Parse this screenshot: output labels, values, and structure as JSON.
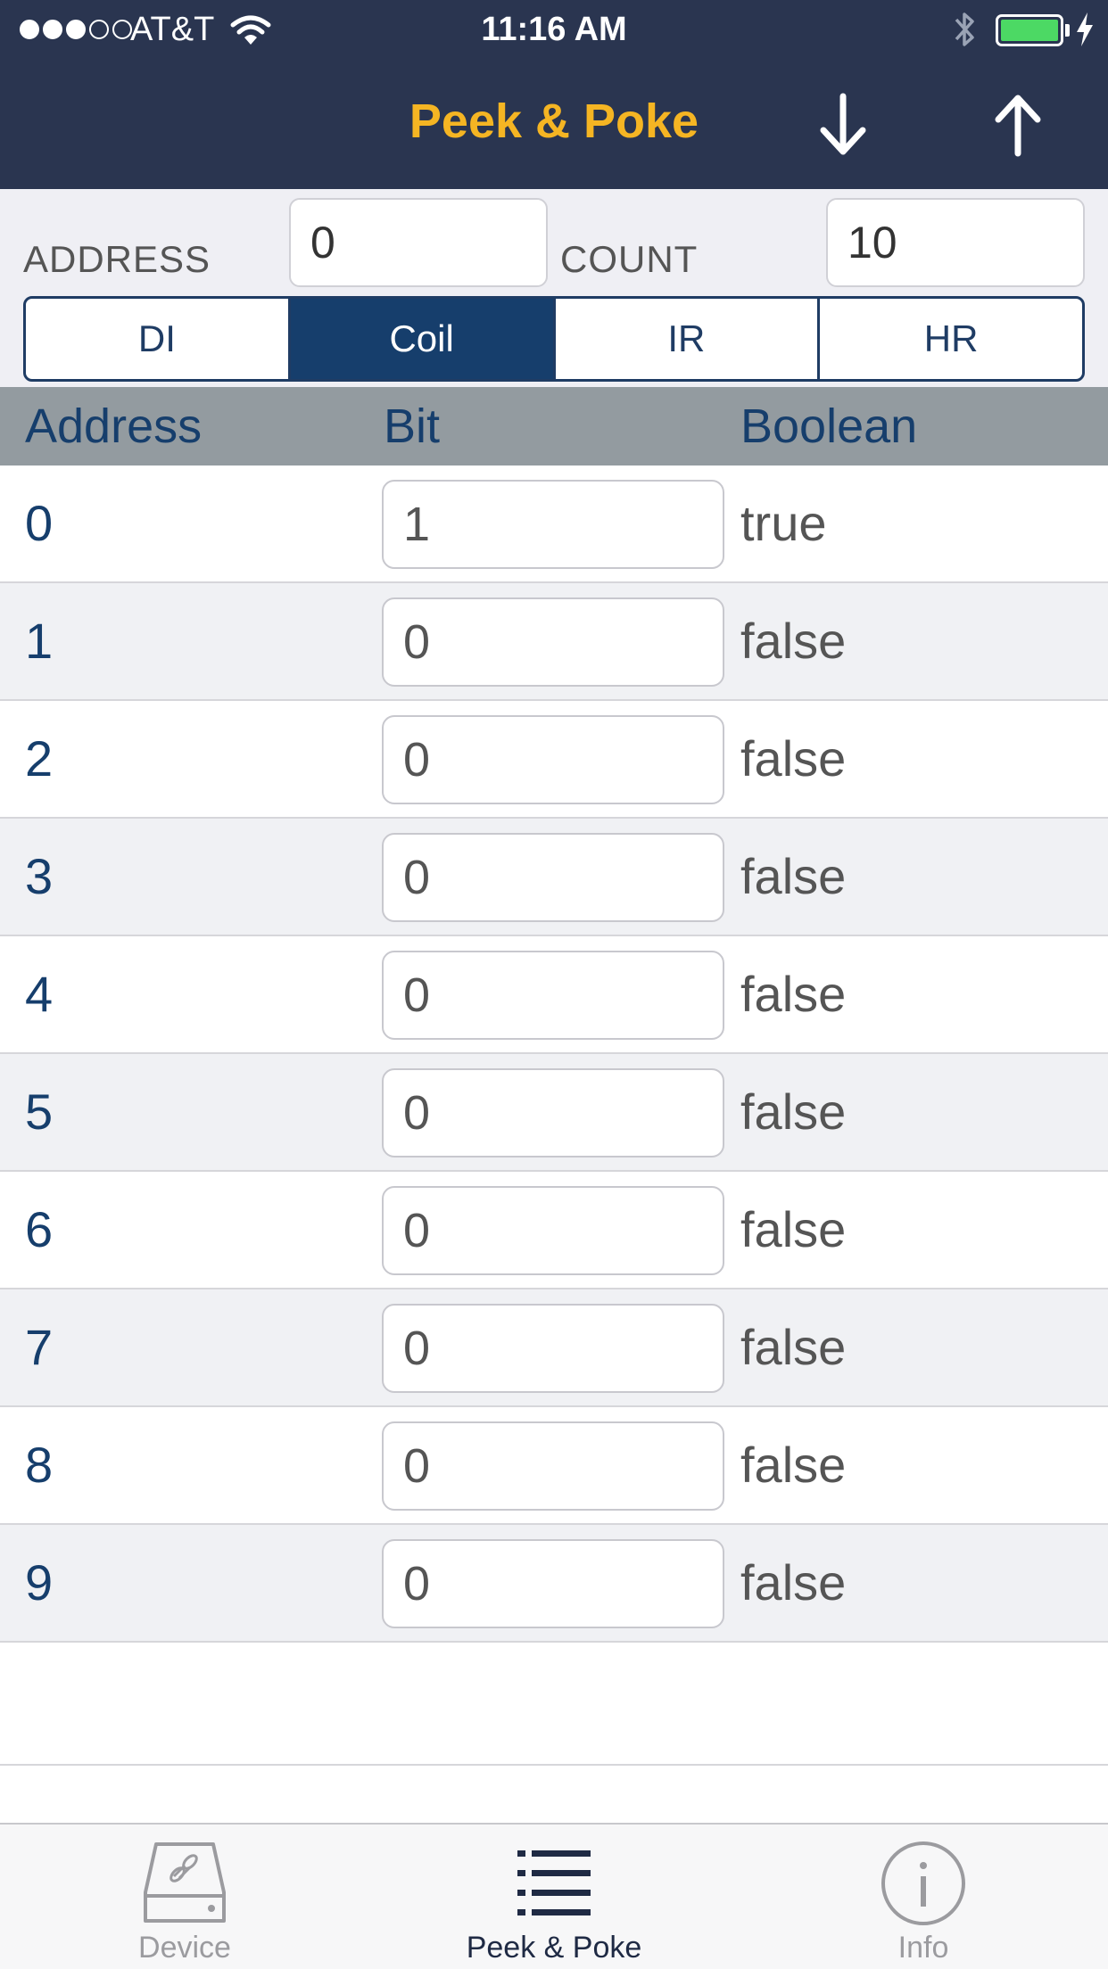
{
  "status_bar": {
    "carrier": "AT&T",
    "time": "11:16 AM",
    "signal_bars_filled": 3,
    "signal_bars_total": 5,
    "battery_level": 1.0,
    "charging": true
  },
  "nav": {
    "title": "Peek & Poke",
    "read_icon": "arrow-down-icon",
    "write_icon": "arrow-up-icon",
    "title_color": "#f5b523",
    "bar_color": "#2a3550"
  },
  "query": {
    "address_label": "ADDRESS",
    "address_value": "0",
    "count_label": "COUNT",
    "count_value": "10"
  },
  "segments": [
    {
      "label": "DI",
      "selected": false
    },
    {
      "label": "Coil",
      "selected": true
    },
    {
      "label": "IR",
      "selected": false
    },
    {
      "label": "HR",
      "selected": false
    }
  ],
  "table": {
    "headers": [
      "Address",
      "Bit",
      "Boolean"
    ],
    "rows": [
      {
        "address": "0",
        "bit": "1",
        "boolean": "true"
      },
      {
        "address": "1",
        "bit": "0",
        "boolean": "false"
      },
      {
        "address": "2",
        "bit": "0",
        "boolean": "false"
      },
      {
        "address": "3",
        "bit": "0",
        "boolean": "false"
      },
      {
        "address": "4",
        "bit": "0",
        "boolean": "false"
      },
      {
        "address": "5",
        "bit": "0",
        "boolean": "false"
      },
      {
        "address": "6",
        "bit": "0",
        "boolean": "false"
      },
      {
        "address": "7",
        "bit": "0",
        "boolean": "false"
      },
      {
        "address": "8",
        "bit": "0",
        "boolean": "false"
      },
      {
        "address": "9",
        "bit": "0",
        "boolean": "false"
      }
    ]
  },
  "tabs": [
    {
      "label": "Device",
      "icon": "device-drive-icon",
      "active": false
    },
    {
      "label": "Peek & Poke",
      "icon": "list-icon",
      "active": true
    },
    {
      "label": "Info",
      "icon": "info-icon",
      "active": false
    }
  ],
  "colors": {
    "accent": "#163e6c",
    "battery": "#4cd964"
  }
}
